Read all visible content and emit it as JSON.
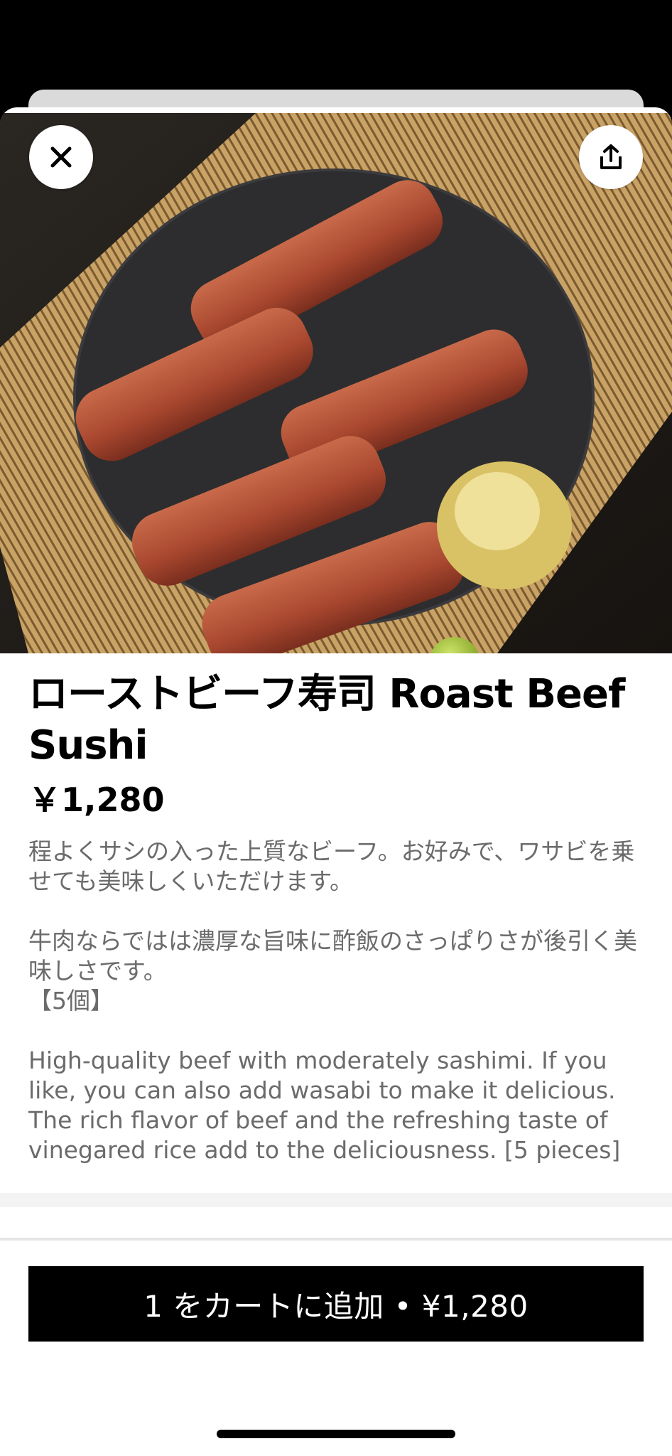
{
  "item": {
    "title": "ローストビーフ寿司 Roast Beef Sushi",
    "price": "￥1,280",
    "description": "程よくサシの入った上質なビーフ。お好みで、ワサビを乗せても美味しくいただけます。\n\n牛肉ならではは濃厚な旨味に酢飯のさっぱりさが後引く美味しさです。\n【5個】\n\nHigh-quality beef with moderately sashimi. If you like, you can also add wasabi to make it delicious. The rich flavor of beef and the refreshing taste of vinegared rice add to the deliciousness. [5 pieces]"
  },
  "cart": {
    "add_label": "1 をカートに追加 • ¥1,280"
  },
  "icons": {
    "close": "close-icon",
    "share": "share-icon"
  },
  "colors": {
    "primary": "#000000",
    "text_muted": "#6b6b6b"
  }
}
